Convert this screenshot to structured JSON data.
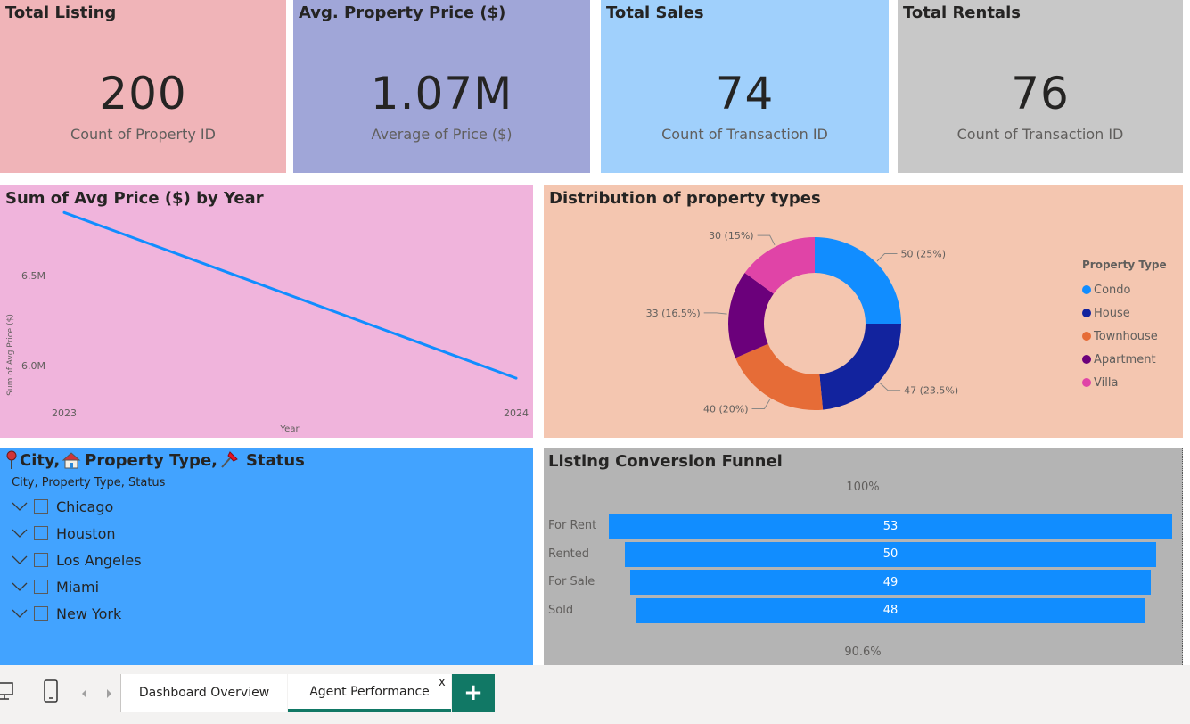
{
  "kpis": [
    {
      "title": "Total Listing",
      "value": "200",
      "sub": "Count of Property ID",
      "color": "#f0b4b8"
    },
    {
      "title": "Avg. Property Price ($)",
      "value": "1.07M",
      "sub": "Average of Price ($)",
      "color": "#a0a6d8"
    },
    {
      "title": "Total Sales",
      "value": "74",
      "sub": "Count of Transaction ID",
      "color": "#a0d0fc"
    },
    {
      "title": "Total Rentals",
      "value": "76",
      "sub": "Count of Transaction ID",
      "color": "#c8c8c8"
    }
  ],
  "line_panel": {
    "title": "Sum of Avg Price ($) by Year",
    "bg": "#f0b4dc"
  },
  "donut_panel": {
    "title": "Distribution of property types",
    "bg": "#f4c6b0"
  },
  "slicer": {
    "title_parts": [
      "City,",
      "Property Type,",
      "Status"
    ],
    "header": "City, Property Type, Status",
    "items": [
      "Chicago",
      "Houston",
      "Los Angeles",
      "Miami",
      "New York"
    ],
    "bg": "#42a3ff",
    "icons": [
      "pin-icon",
      "house-icon",
      "pushpin-icon"
    ]
  },
  "funnel_panel": {
    "title": "Listing Conversion Funnel",
    "bg": "#b4b4b4",
    "top_pct": "100%",
    "bottom_pct": "90.6%"
  },
  "chart_data": [
    {
      "type": "line",
      "title": "Sum of Avg Price ($) by Year",
      "xlabel": "Year",
      "ylabel": "Sum of Avg Price ($)",
      "x": [
        "2023",
        "2024"
      ],
      "series": [
        {
          "values": [
            6.85,
            5.93
          ],
          "color": "#118dff"
        }
      ],
      "y_unit": "M",
      "y_ticks": [
        "6.5M",
        "6.0M"
      ],
      "grid": false
    },
    {
      "type": "pie",
      "title": "Distribution of property types",
      "legend_title": "Property Type",
      "legend_position": "right",
      "categories": [
        "Condo",
        "House",
        "Townhouse",
        "Apartment",
        "Villa"
      ],
      "values": [
        50,
        47,
        40,
        33,
        30
      ],
      "labels": [
        "50 (25%)",
        "47 (23.5%)",
        "40 (20%)",
        "33 (16.5%)",
        "30 (15%)"
      ],
      "colors": [
        "#118dff",
        "#12239e",
        "#e66c37",
        "#6b007b",
        "#e044a7"
      ]
    },
    {
      "type": "bar",
      "title": "Listing Conversion Funnel",
      "categories": [
        "For Rent",
        "Rented",
        "For Sale",
        "Sold"
      ],
      "values": [
        53,
        50,
        49,
        48
      ],
      "color": "#118dff"
    }
  ],
  "tabs": [
    {
      "label": "Dashboard Overview"
    },
    {
      "label": "Agent Performance",
      "active": true
    }
  ],
  "tab_close": "x",
  "add_tab": "+"
}
